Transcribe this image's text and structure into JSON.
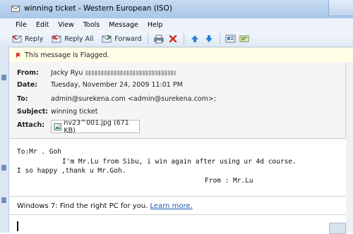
{
  "window": {
    "title": "winning ticket - Western European (ISO)"
  },
  "menu": [
    "File",
    "Edit",
    "View",
    "Tools",
    "Message",
    "Help"
  ],
  "toolbar": {
    "reply": "Reply",
    "reply_all": "Reply All",
    "forward": "Forward"
  },
  "flag": {
    "text": "This message is Flagged."
  },
  "header": {
    "from_label": "From:",
    "from_value": "Jacky Ryu",
    "date_label": "Date:",
    "date_value": "Tuesday, November 24, 2009 11:01 PM",
    "to_label": "To:",
    "to_value": "admin@surekena.com <admin@surekena.com>;",
    "subject_label": "Subject:",
    "subject_value": "winning ticket",
    "attach_label": "Attach:",
    "attach_value": "nv23^001.jpg (671 KB)"
  },
  "body": {
    "line1": "To:Mr . Goh",
    "line2": "I'm Mr.Lu from Sibu, i win again after using ur 4d course.",
    "line3": "I so happy ,thank u Mr.Goh.",
    "line4": "From : Mr.Lu"
  },
  "footer": {
    "text": "Windows 7: Find the right PC for you.",
    "link": "Learn more."
  },
  "colors": {
    "titlebar": "#b9d1ee",
    "flagbar": "#ffffe7",
    "link": "#1a55b5",
    "flag_icon": "#d23b2b"
  }
}
